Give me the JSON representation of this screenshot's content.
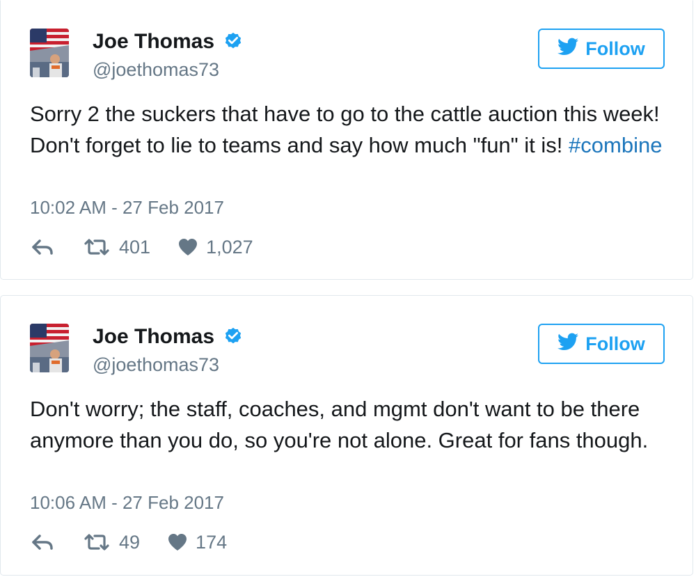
{
  "tweets": [
    {
      "author_name": "Joe Thomas",
      "handle": "@joethomas73",
      "follow_label": "Follow",
      "text_before_hashtag": "Sorry 2 the suckers that have to go to the cattle auction this week! Don't forget to lie to teams and say how much \"fun\" it is! ",
      "hashtag": "#combine",
      "timestamp": "10:02 AM - 27 Feb 2017",
      "retweets": "401",
      "likes": "1,027"
    },
    {
      "author_name": "Joe Thomas",
      "handle": "@joethomas73",
      "follow_label": "Follow",
      "text": "Don't worry; the staff, coaches, and mgmt don't want to be there anymore than you do, so you're not alone. Great for fans though.",
      "timestamp": "10:06 AM - 27 Feb 2017",
      "retweets": "49",
      "likes": "174"
    }
  ],
  "colors": {
    "accent": "#1da1f2",
    "hashtag": "#1b75bb",
    "muted": "#657786",
    "text": "#14171a",
    "border": "#e1e8ed"
  },
  "icons": {
    "verified": "verified-badge-icon",
    "twitter_bird": "twitter-bird-icon",
    "reply": "reply-icon",
    "retweet": "retweet-icon",
    "like": "heart-icon"
  }
}
